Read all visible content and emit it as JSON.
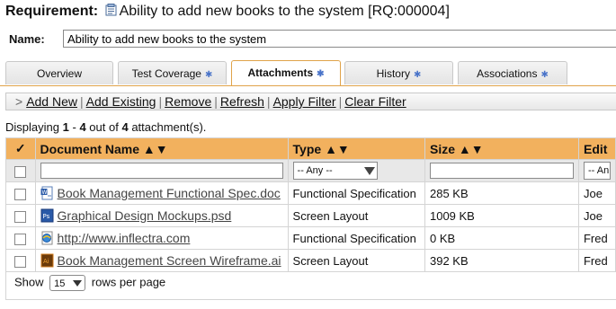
{
  "header": {
    "label": "Requirement:",
    "title": "Ability to add new books to the system [RQ:000004]"
  },
  "name_field": {
    "label": "Name:",
    "value": "Ability to add new books to the system"
  },
  "tabs": [
    {
      "label": "Overview",
      "star": ""
    },
    {
      "label": "Test Coverage",
      "star": "✱"
    },
    {
      "label": "Attachments",
      "star": "✱"
    },
    {
      "label": "History",
      "star": "✱"
    },
    {
      "label": "Associations",
      "star": "✱"
    }
  ],
  "toolbar": {
    "prefix": ">",
    "add_new": "Add New",
    "add_existing": "Add Existing",
    "remove": "Remove",
    "refresh": "Refresh",
    "apply_filter": "Apply Filter",
    "clear_filter": "Clear Filter",
    "sep": "|"
  },
  "summary": {
    "prefix": "Displaying",
    "from": "1",
    "dash": "-",
    "to": "4",
    "mid": "out of",
    "total": "4",
    "suffix": "attachment(s)."
  },
  "columns": {
    "check": "✓",
    "document": "Document Name ▲▼",
    "type": "Type ▲▼",
    "size": "Size ▲▼",
    "editor": "Edit"
  },
  "filters": {
    "type_select": "-- Any --",
    "editor_select": "-- An"
  },
  "rows": [
    {
      "name": "Book Management Functional Spec.doc",
      "icon": "word-doc-icon",
      "type": "Functional Specification",
      "size": "285 KB",
      "editor": "Joe"
    },
    {
      "name": "Graphical Design Mockups.psd",
      "icon": "photoshop-file-icon",
      "type": "Screen Layout",
      "size": "1009 KB",
      "editor": "Joe"
    },
    {
      "name": "http://www.inflectra.com",
      "icon": "web-link-icon",
      "type": "Functional Specification",
      "size": "0 KB",
      "editor": "Fred"
    },
    {
      "name": "Book Management Screen Wireframe.ai",
      "icon": "illustrator-file-icon",
      "type": "Screen Layout",
      "size": "392 KB",
      "editor": "Fred"
    }
  ],
  "pager": {
    "show": "Show",
    "page_size": "15",
    "rows_per_page": "rows per page"
  },
  "colors": {
    "header_bg": "#f2b15e",
    "tab_active_border": "#e0a34a",
    "star": "#4a74c9"
  }
}
